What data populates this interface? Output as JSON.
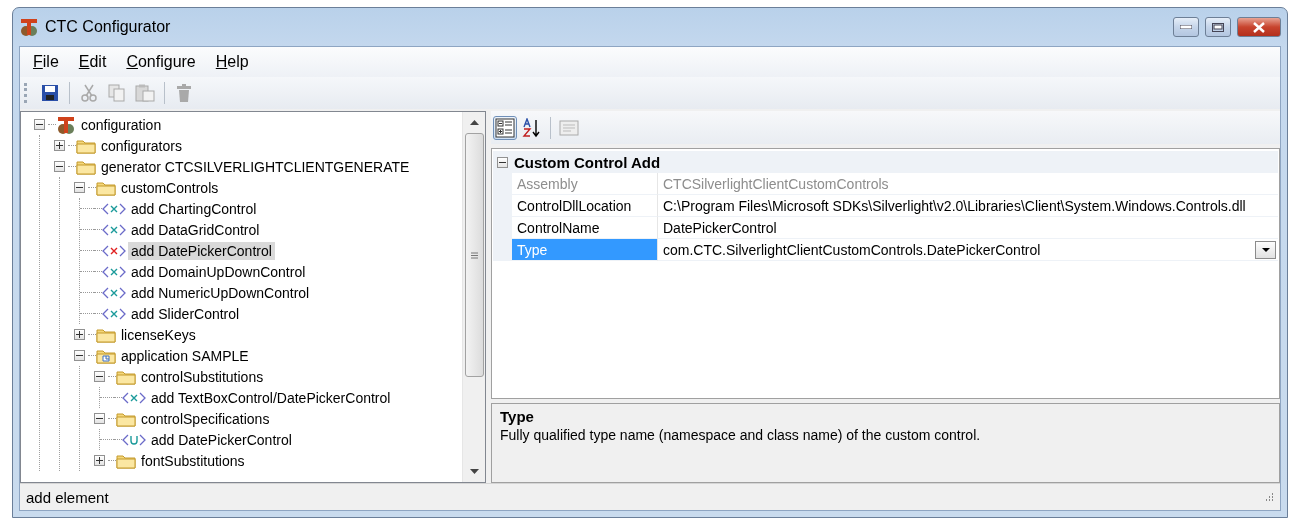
{
  "window": {
    "title": "CTC Configurator"
  },
  "menu": [
    {
      "label": "File"
    },
    {
      "label": "Edit"
    },
    {
      "label": "Configure"
    },
    {
      "label": "Help"
    }
  ],
  "toolbar": [
    {
      "kind": "save",
      "disabled": false
    },
    {
      "kind": "separator"
    },
    {
      "kind": "cut",
      "disabled": true
    },
    {
      "kind": "copy",
      "disabled": true
    },
    {
      "kind": "paste",
      "disabled": true
    },
    {
      "kind": "separator"
    },
    {
      "kind": "delete",
      "disabled": true
    }
  ],
  "tree": {
    "items": [
      {
        "label": "configuration",
        "kind": "root",
        "expanded": true,
        "selected": false,
        "children": [
          {
            "label": "configurators",
            "kind": "folder",
            "expanded": false,
            "selected": false
          },
          {
            "label": "generator CTCSILVERLIGHTCLIENTGENERATE",
            "kind": "folder",
            "expanded": true,
            "selected": false,
            "children": [
              {
                "label": "customControls",
                "kind": "folder",
                "expanded": true,
                "selected": false,
                "children": [
                  {
                    "label": "add ChartingControl",
                    "kind": "element",
                    "selected": false
                  },
                  {
                    "label": "add DataGridControl",
                    "kind": "element",
                    "selected": false
                  },
                  {
                    "label": "add DatePickerControl",
                    "kind": "element",
                    "selected": true
                  },
                  {
                    "label": "add DomainUpDownControl",
                    "kind": "element",
                    "selected": false
                  },
                  {
                    "label": "add NumericUpDownControl",
                    "kind": "element",
                    "selected": false
                  },
                  {
                    "label": "add SliderControl",
                    "kind": "element",
                    "selected": false
                  }
                ]
              },
              {
                "label": "licenseKeys",
                "kind": "folder",
                "expanded": false,
                "selected": false
              },
              {
                "label": "application SAMPLE",
                "kind": "app-folder",
                "expanded": true,
                "selected": false,
                "children": [
                  {
                    "label": "controlSubstitutions",
                    "kind": "folder",
                    "expanded": true,
                    "selected": false,
                    "children": [
                      {
                        "label": "add TextBoxControl/DatePickerControl",
                        "kind": "element",
                        "selected": false
                      }
                    ]
                  },
                  {
                    "label": "controlSpecifications",
                    "kind": "folder",
                    "expanded": true,
                    "selected": false,
                    "children": [
                      {
                        "label": "add DatePickerControl",
                        "kind": "unique",
                        "selected": false
                      }
                    ]
                  },
                  {
                    "label": "fontSubstitutions",
                    "kind": "folder",
                    "expanded": false,
                    "selected": false
                  }
                ]
              }
            ]
          }
        ]
      }
    ]
  },
  "property_grid": {
    "toolbar": [
      {
        "kind": "categorized",
        "selected": true,
        "disabled": false
      },
      {
        "kind": "alphabetical",
        "selected": false,
        "disabled": false
      },
      {
        "kind": "separator"
      },
      {
        "kind": "property-pages",
        "selected": false,
        "disabled": true
      }
    ],
    "category": {
      "title": "Custom Control Add",
      "expanded": true
    },
    "rows": [
      {
        "name": "Assembly",
        "value": "CTCSilverlightClientCustomControls",
        "disabled": true,
        "selected": false,
        "kind": "text"
      },
      {
        "name": "ControlDllLocation",
        "value": "C:\\Program Files\\Microsoft SDKs\\Silverlight\\v2.0\\Libraries\\Client\\System.Windows.Controls.dll",
        "disabled": false,
        "selected": false,
        "kind": "text"
      },
      {
        "name": "ControlName",
        "value": "DatePickerControl",
        "disabled": false,
        "selected": false,
        "kind": "text"
      },
      {
        "name": "Type",
        "value": "com.CTC.SilverlightClientCustomControls.DatePickerControl",
        "disabled": false,
        "selected": true,
        "kind": "dropdown"
      }
    ],
    "description": {
      "title": "Type",
      "text": "Fully qualified type name (namespace and class name) of the custom control."
    }
  },
  "status_bar": {
    "text": "add element"
  }
}
